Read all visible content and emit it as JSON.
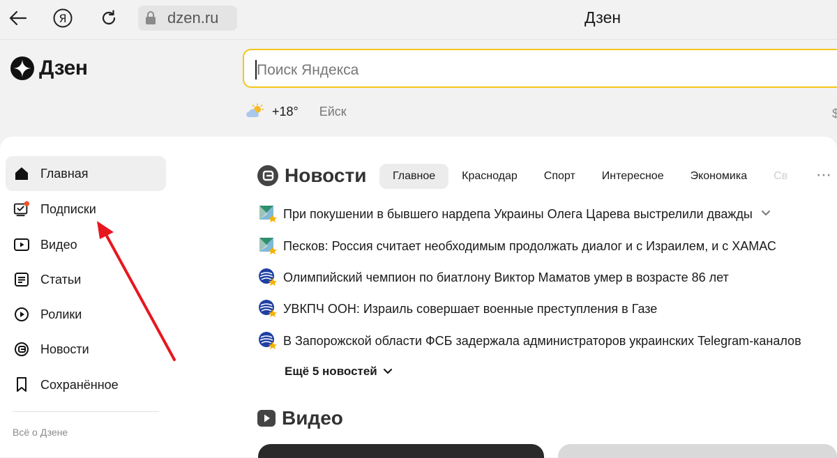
{
  "browser": {
    "url": "dzen.ru",
    "tab_title": "Дзен"
  },
  "header": {
    "logo_text": "Дзен",
    "search_placeholder": "Поиск Яндекса",
    "weather_temp": "+18°",
    "weather_city": "Ейск",
    "cut_char": "$"
  },
  "sidebar": {
    "items": [
      {
        "label": "Главная",
        "icon": "home-icon"
      },
      {
        "label": "Подписки",
        "icon": "subscriptions-icon"
      },
      {
        "label": "Видео",
        "icon": "video-icon"
      },
      {
        "label": "Статьи",
        "icon": "articles-icon"
      },
      {
        "label": "Ролики",
        "icon": "clips-icon"
      },
      {
        "label": "Новости",
        "icon": "news-icon"
      },
      {
        "label": "Сохранённое",
        "icon": "bookmark-icon"
      }
    ],
    "about": "Всё о Дзене"
  },
  "news": {
    "title": "Новости",
    "tabs": [
      "Главное",
      "Краснодар",
      "Спорт",
      "Интересное",
      "Экономика",
      "Св"
    ],
    "items": [
      "При покушении в бывшего нардепа Украины Олега Царева выстрелили дважды",
      "Песков: Россия считает необходимым продолжать диалог и с Израилем, и с ХАМАС",
      "Олимпийский чемпион по биатлону Виктор Маматов умер в возрасте 86 лет",
      "УВКПЧ ООН: Израиль совершает военные преступления в Газе",
      "В Запорожской области ФСБ задержала администраторов украинских Telegram-каналов"
    ],
    "more": "Ещё 5 новостей"
  },
  "video": {
    "title": "Видео"
  },
  "colors": {
    "search_border": "#f5c518",
    "badge": "#f0522b",
    "arrow": "#e8161e",
    "source_blue": "#1f3fa3",
    "source_green": "#2f8f6f"
  }
}
